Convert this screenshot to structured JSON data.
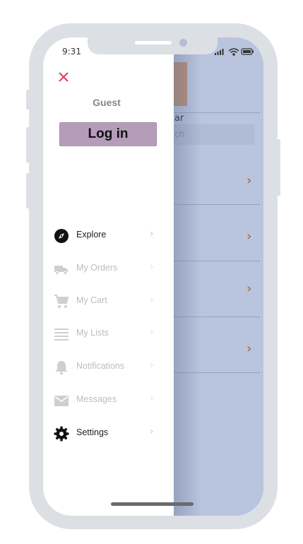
{
  "status_bar": {
    "time": "9:31"
  },
  "background_app": {
    "partial_label": "ar",
    "search_partial": "ch"
  },
  "drawer": {
    "user_name": "Guest",
    "login_label": "Log in",
    "items": [
      {
        "label": "Explore",
        "icon": "compass-icon",
        "enabled": true
      },
      {
        "label": "My Orders",
        "icon": "truck-icon",
        "enabled": false
      },
      {
        "label": "My Cart",
        "icon": "cart-icon",
        "enabled": false
      },
      {
        "label": "My Lists",
        "icon": "list-icon",
        "enabled": false
      },
      {
        "label": "Notifications",
        "icon": "bell-icon",
        "enabled": false
      },
      {
        "label": "Messages",
        "icon": "envelope-icon",
        "enabled": false
      },
      {
        "label": "Settings",
        "icon": "gear-icon",
        "enabled": true
      }
    ]
  },
  "colors": {
    "close_icon": "#e0405a",
    "login_button": "#b59dba",
    "overlay": "#b9c4de",
    "chevron_accent": "#b07a4a"
  }
}
